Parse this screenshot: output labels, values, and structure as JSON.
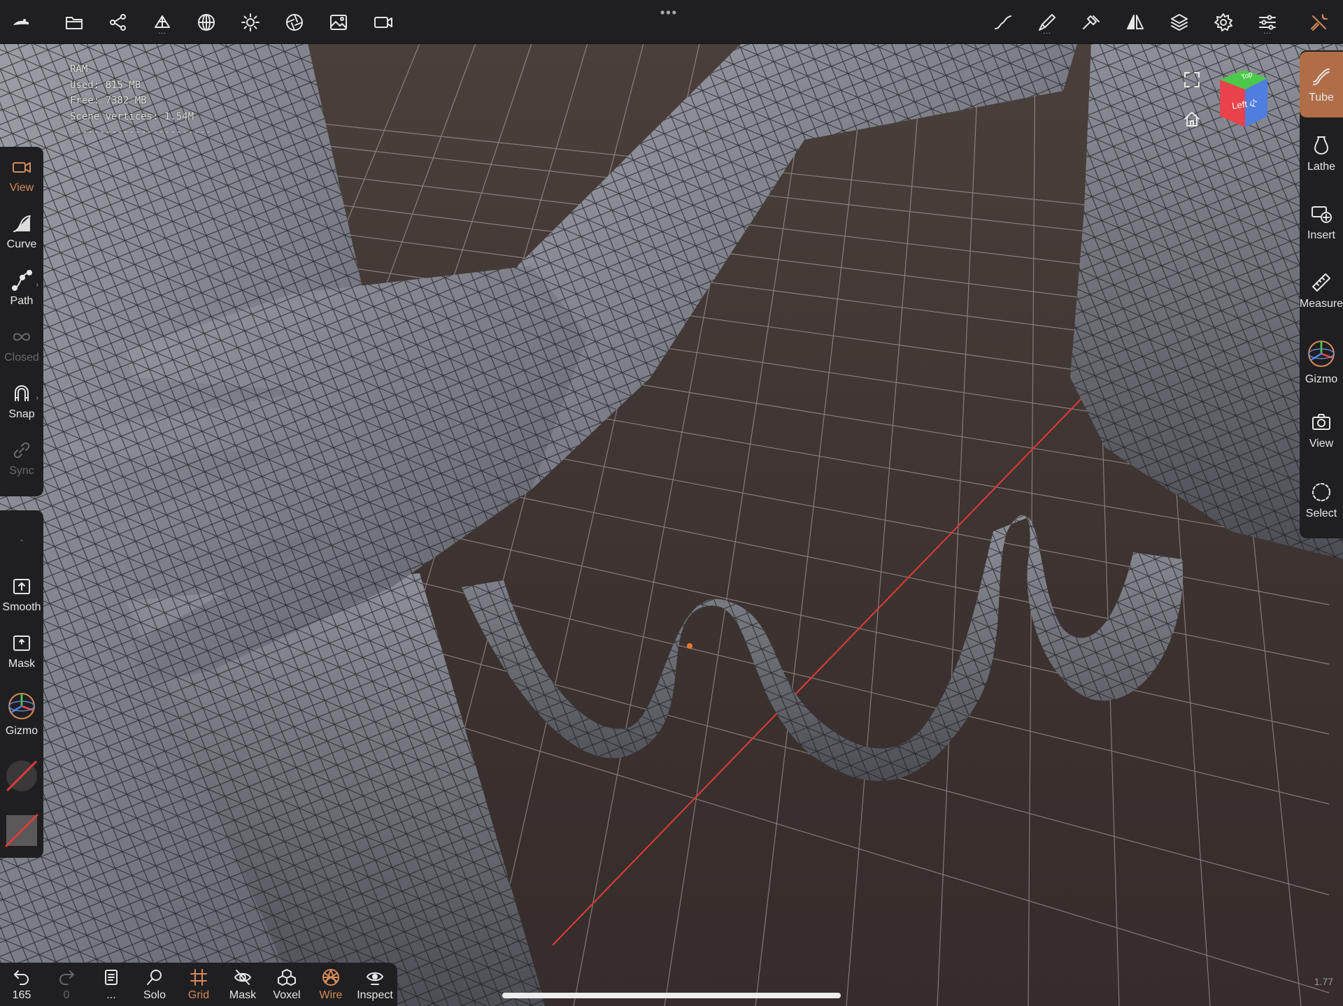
{
  "app": {
    "name": "Nomad Sculpt"
  },
  "topbar": {
    "handle": "•••",
    "left_icons": [
      "nomad-logo-icon",
      "folder-icon",
      "scene-graph-icon",
      "mesh-topology-icon",
      "material-sphere-icon",
      "light-sun-icon",
      "post-process-icon",
      "background-image-icon",
      "camera-icon"
    ],
    "right_icons": [
      "stroke-icon",
      "brush-icon",
      "hammer-icon",
      "symmetry-icon",
      "layers-icon",
      "settings-gear-icon",
      "sliders-icon",
      "tools-wrench-icon"
    ],
    "more_marker": "..."
  },
  "stats": {
    "ram": "RAM",
    "used": "Used:  815 MB",
    "free": "Free:  7382 MB",
    "vertices": "Scene vertices:  1.54M",
    "separator": "------------------------"
  },
  "left_toolbar": {
    "items": [
      {
        "label": "View",
        "icon": "video-camera-icon",
        "state": "active"
      },
      {
        "label": "Curve",
        "icon": "curve-icon",
        "state": "normal"
      },
      {
        "label": "Path",
        "icon": "path-icon",
        "state": "normal"
      },
      {
        "label": "Closed",
        "icon": "infinity-icon",
        "state": "disabled"
      },
      {
        "label": "Snap",
        "icon": "magnet-icon",
        "state": "normal"
      },
      {
        "label": "Sync",
        "icon": "link-icon",
        "state": "disabled"
      }
    ],
    "second_group": [
      {
        "label": "-",
        "icon": "none"
      },
      {
        "label": "Smooth",
        "icon": "smooth-up-icon"
      },
      {
        "label": "Mask",
        "icon": "mask-up-icon"
      },
      {
        "label": "Gizmo",
        "icon": "gizmo-axes-icon"
      }
    ]
  },
  "right_toolbar": {
    "items": [
      {
        "label": "Tube",
        "icon": "tube-curve-icon",
        "state": "active"
      },
      {
        "label": "Lathe",
        "icon": "lathe-vase-icon",
        "state": "normal"
      },
      {
        "label": "Insert",
        "icon": "insert-plus-icon",
        "state": "normal"
      },
      {
        "label": "Measure",
        "icon": "ruler-icon",
        "state": "normal"
      },
      {
        "label": "Gizmo",
        "icon": "gizmo-axes-icon",
        "state": "normal"
      },
      {
        "label": "View",
        "icon": "camera-snapshot-icon",
        "state": "normal"
      },
      {
        "label": "Select",
        "icon": "dashed-circle-icon",
        "state": "normal"
      }
    ]
  },
  "navcube": {
    "left_face": "Left",
    "front_face": "Fr",
    "top_face": "Top",
    "colors": {
      "left": "#e8424a",
      "top": "#4cc84a",
      "front": "#4f7de0"
    }
  },
  "bottom_toolbar": {
    "items": [
      {
        "label": "165",
        "icon": "undo-icon",
        "state": "normal"
      },
      {
        "label": "0",
        "icon": "redo-icon",
        "state": "disabled"
      },
      {
        "label": "...",
        "icon": "history-book-icon",
        "state": "normal"
      },
      {
        "label": "Solo",
        "icon": "search-icon",
        "state": "normal"
      },
      {
        "label": "Grid",
        "icon": "grid-icon",
        "state": "active"
      },
      {
        "label": "Mask",
        "icon": "eye-hidden-icon",
        "state": "normal"
      },
      {
        "label": "Voxel",
        "icon": "voxel-cubes-icon",
        "state": "normal"
      },
      {
        "label": "Wire",
        "icon": "wireframe-icon",
        "state": "active"
      },
      {
        "label": "Inspect",
        "icon": "inspect-eye-icon",
        "state": "normal"
      }
    ]
  },
  "zoom_label": "1.77",
  "colors": {
    "accent": "#d58a5a",
    "panel": "#1f1f21",
    "axis_red": "#e23a3a"
  }
}
